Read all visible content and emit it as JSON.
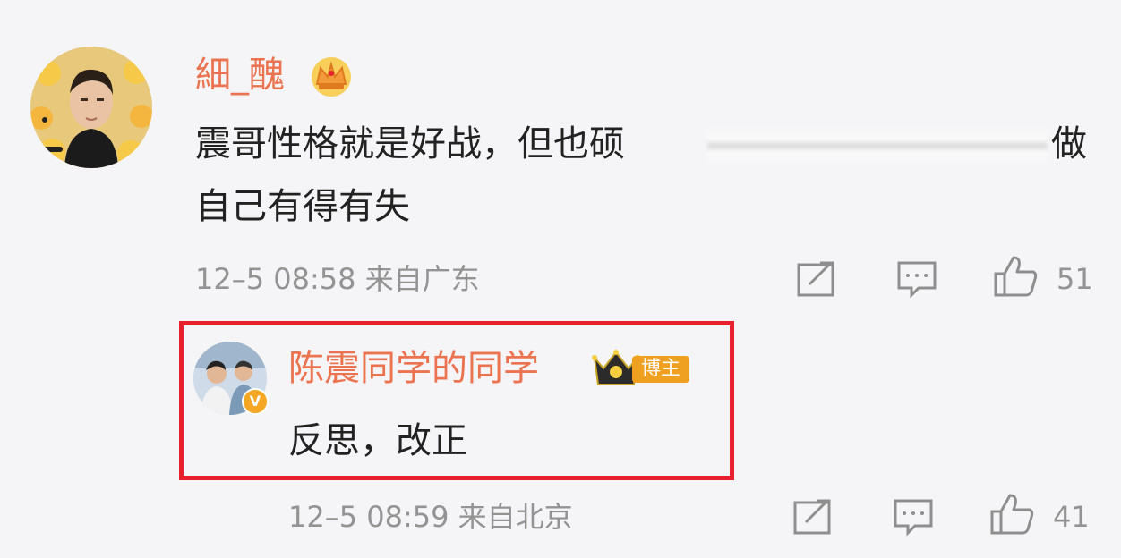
{
  "comments": [
    {
      "username": "細_醜",
      "text_line1_start": "震哥性格就是好战，但也硕",
      "text_line1_end": "做",
      "text_line2": "自己有得有失",
      "meta": "12–5 08:58 来自广东",
      "like_count": "51",
      "icons": [
        "crown-icon",
        "share-icon",
        "comment-icon",
        "thumbs-up-icon"
      ]
    },
    {
      "username": "陈震同学的同学",
      "badge": "博主",
      "verified_mark": "V",
      "text": "反思，改正",
      "meta": "12–5 08:59 来自北京",
      "like_count": "41",
      "icons": [
        "crown-icon",
        "share-icon",
        "comment-icon",
        "thumbs-up-icon"
      ]
    }
  ],
  "colors": {
    "username": "#eb7350",
    "highlight_border": "#e8202c",
    "meta_text": "#939393",
    "badge_bg": "#f0a020"
  }
}
